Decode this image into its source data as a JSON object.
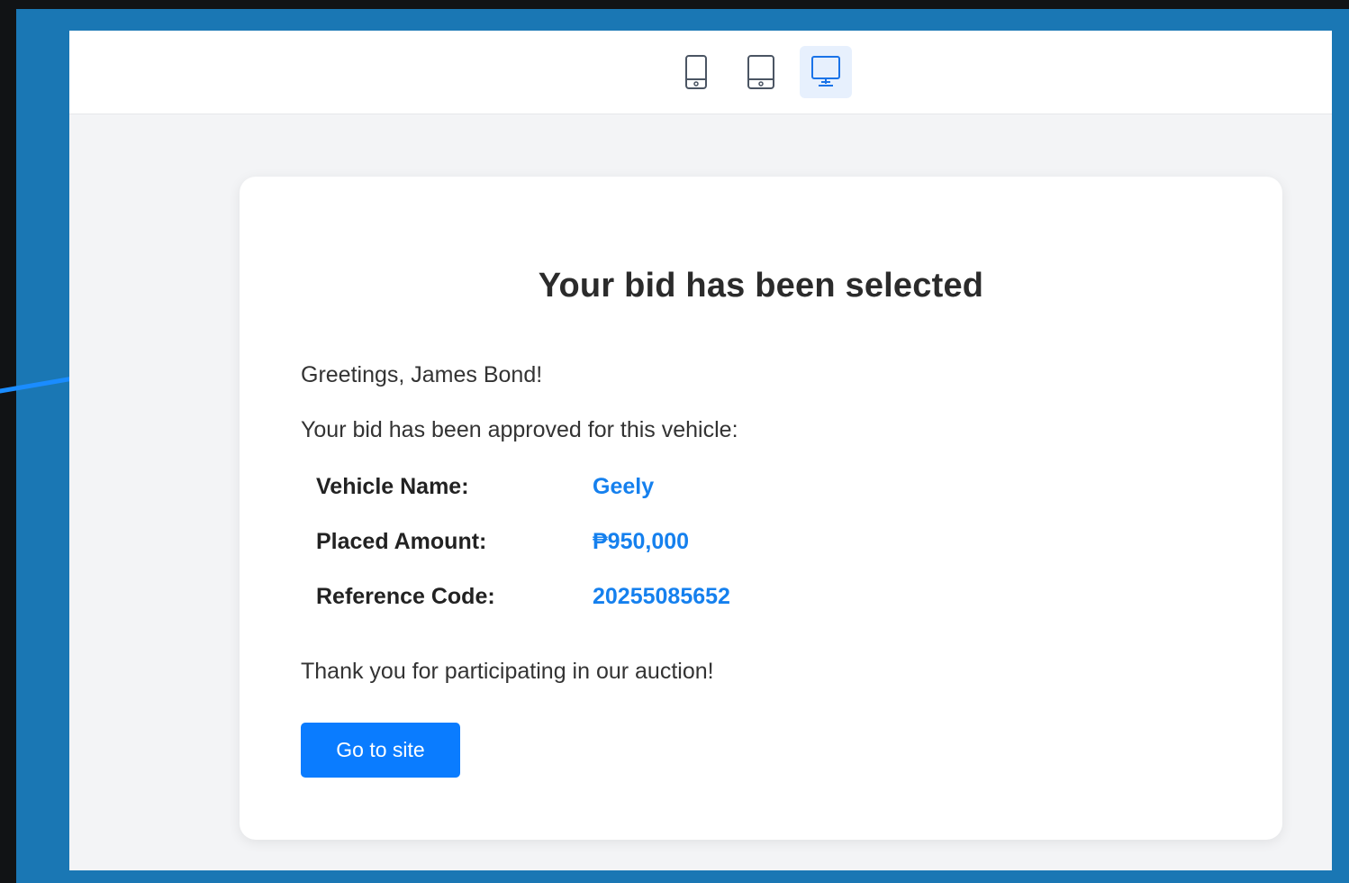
{
  "toolbar": {
    "devices": [
      {
        "icon": "mobile-icon",
        "active": false
      },
      {
        "icon": "tablet-icon",
        "active": false
      },
      {
        "icon": "desktop-icon",
        "active": true
      }
    ]
  },
  "email": {
    "title": "Your bid has been selected",
    "greeting": "Greetings, James Bond!",
    "intro": "Your bid has been approved for this vehicle:",
    "details": [
      {
        "label": "Vehicle Name:",
        "value": "Geely"
      },
      {
        "label": "Placed Amount:",
        "value": "₱950,000"
      },
      {
        "label": "Reference Code:",
        "value": "20255085652"
      }
    ],
    "closing": "Thank you for participating in our auction!",
    "button_label": "Go to site"
  },
  "colors": {
    "frame": "#1a77b4",
    "accent": "#0a7cff",
    "value_text": "#1580ee",
    "annotation_arrow": "#1a8cff"
  }
}
